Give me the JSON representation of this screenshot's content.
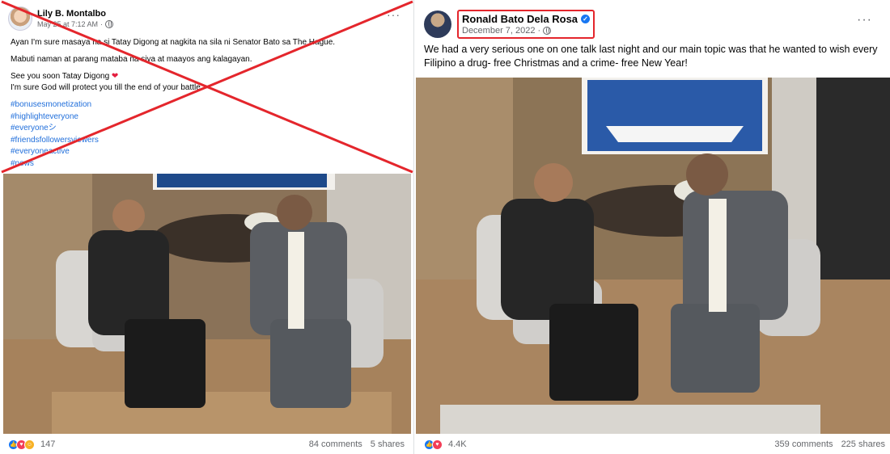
{
  "left_post": {
    "author": "Lily B. Montalbo",
    "timestamp": "May 25 at 7:12 AM",
    "more_label": "···",
    "text": {
      "line1": "Ayan I'm sure masaya na si Tatay Digong at nagkita na sila ni Senator Bato sa The Hague.",
      "line2": "Mabuti naman at parang mataba na siya at maayos ang kalagayan.",
      "line3": "See you soon Tatay Digong",
      "heart": "❤",
      "line4": "I'm sure God will protect you till the end of your battle."
    },
    "hashtags": [
      "#bonusesmonetization",
      "#highlighteveryone",
      "#everyoneシ",
      "#friendsfollowersviewers",
      "#everyoneactive",
      "#news"
    ],
    "footer": {
      "reactions": "147",
      "comments": "84 comments",
      "shares": "5 shares"
    }
  },
  "right_post": {
    "author": "Ronald Bato Dela Rosa",
    "verified_icon": "✓",
    "timestamp": "December 7, 2022 ·",
    "more_label": "···",
    "text": "We had a very serious one on one talk last night and our main topic was that he wanted to wish every Filipino a drug- free Christmas and a crime- free New Year!",
    "footer": {
      "reactions": "4.4K",
      "comments": "359 comments",
      "shares": "225 shares"
    }
  },
  "colors": {
    "cross": "#e4262c",
    "highlight_box": "#e4262c",
    "link": "#216fdb",
    "muted": "#65676b"
  },
  "icons": {
    "reactions": [
      "like-icon",
      "love-icon",
      "care-icon"
    ],
    "audience": "globe-icon",
    "verified": "verified-badge-icon"
  }
}
